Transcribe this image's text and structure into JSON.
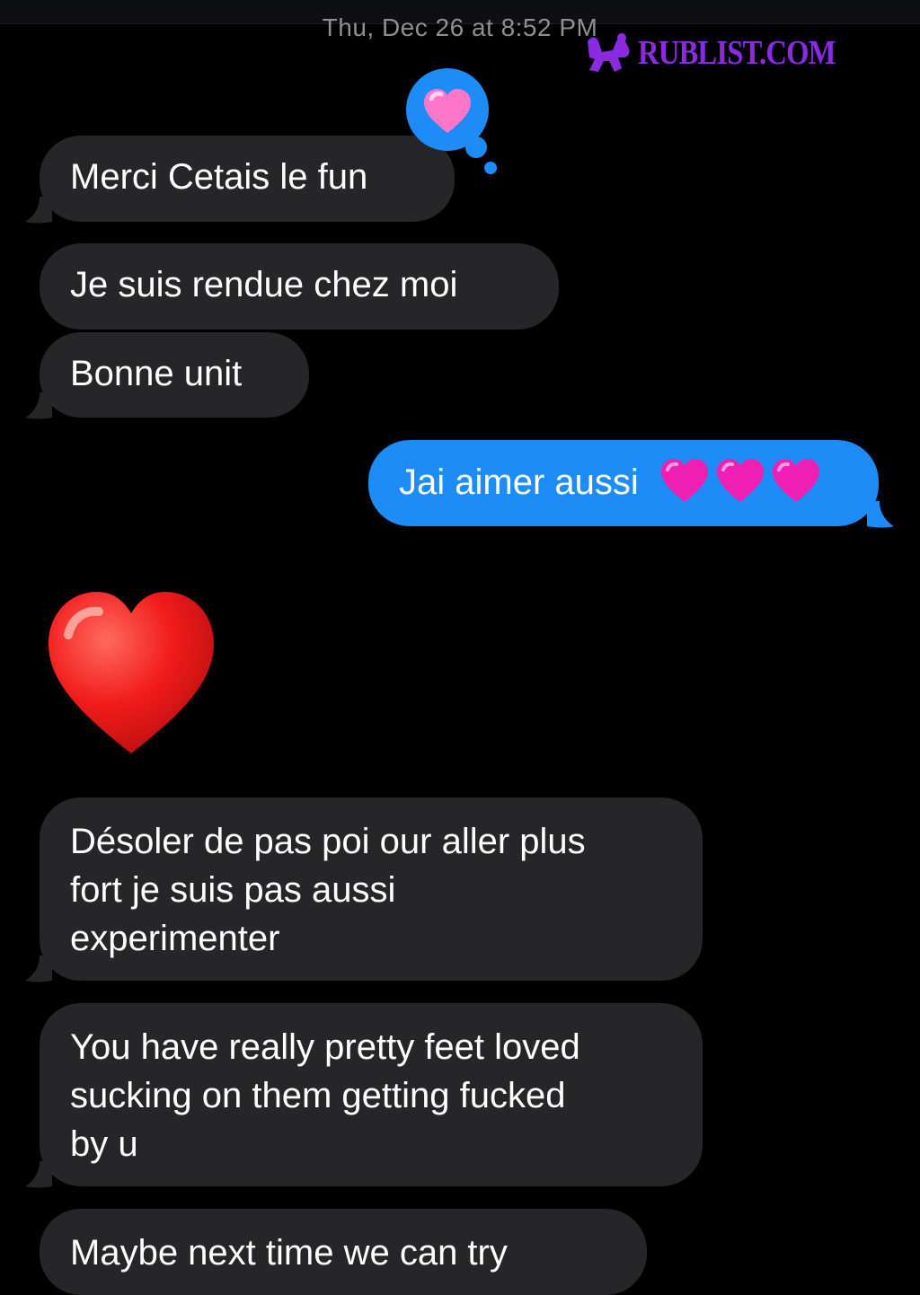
{
  "header": {
    "timestamp": "Thu, Dec 26 at 8:52 PM"
  },
  "watermark": {
    "text": "RUBLIST.COM",
    "color": "#8a2be2"
  },
  "colors": {
    "background": "#000000",
    "received_bubble": "#262628",
    "sent_bubble": "#1e8cf7",
    "timestamp": "#8e8e93"
  },
  "messages": [
    {
      "direction": "received",
      "text": "Merci Cetais le fun",
      "reaction": "pink-heart-icon"
    },
    {
      "direction": "received",
      "text": "Je suis rendue chez moi"
    },
    {
      "direction": "received",
      "text": "Bonne unit"
    },
    {
      "direction": "sent",
      "text": "Jai aimer aussi",
      "emoji": [
        "pink-heart-icon",
        "pink-heart-icon",
        "pink-heart-icon"
      ]
    },
    {
      "direction": "received",
      "emoji": "red-heart-icon"
    },
    {
      "direction": "received",
      "lines": [
        "Désoler de pas poi our aller plus",
        "fort je suis pas aussi",
        "experimenter"
      ]
    },
    {
      "direction": "received",
      "lines": [
        "You have really pretty feet loved",
        "sucking on them getting fucked",
        "by u"
      ]
    },
    {
      "direction": "received",
      "text": "Maybe next time we can try"
    }
  ]
}
